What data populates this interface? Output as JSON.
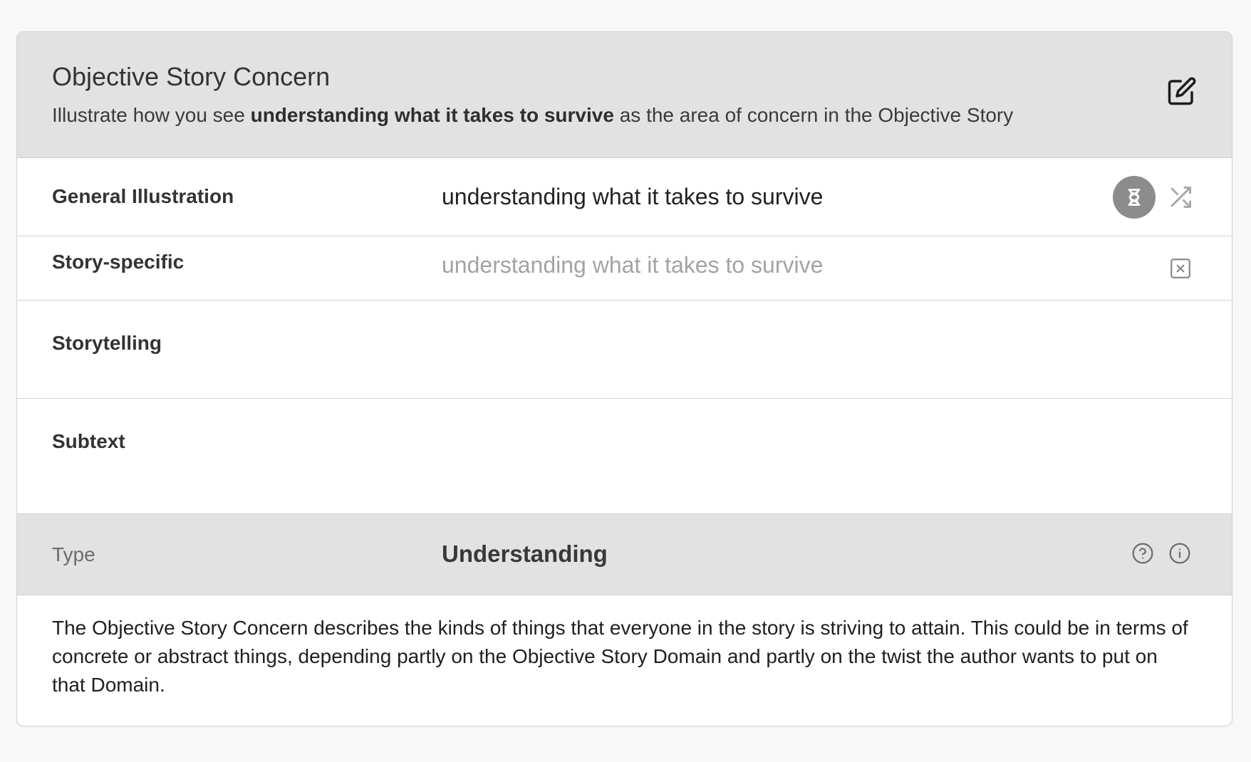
{
  "header": {
    "title": "Objective Story Concern",
    "subtitle_prefix": "Illustrate how you see ",
    "subtitle_bold": "understanding what it takes to survive",
    "subtitle_suffix": " as the area of concern in the Objective Story",
    "edit_icon": "edit-icon"
  },
  "rows": {
    "general": {
      "label": "General Illustration",
      "value": "understanding what it takes to survive",
      "dna_icon": "dna-icon",
      "shuffle_icon": "shuffle-icon"
    },
    "specific": {
      "label": "Story-specific",
      "placeholder": "understanding what it takes to survive",
      "clear_icon": "clear-x-icon"
    },
    "storytelling": {
      "label": "Storytelling",
      "value": ""
    },
    "subtext": {
      "label": "Subtext",
      "value": ""
    },
    "type": {
      "label": "Type",
      "value": "Understanding",
      "help_icon": "question-circle-icon",
      "info_icon": "info-circle-icon"
    }
  },
  "description": "The Objective Story Concern describes the kinds of things that everyone in the story is striving to attain. This could be in terms of concrete or abstract things, depending partly on the Objective Story Domain and partly on the twist the author wants to put on that Domain.",
  "colors": {
    "page_background": "#f8f8f8",
    "header_background": "#e2e2e2",
    "card_background": "#ffffff",
    "placeholder_text": "#a3a3a3",
    "dna_button": "#8c8c8c"
  }
}
